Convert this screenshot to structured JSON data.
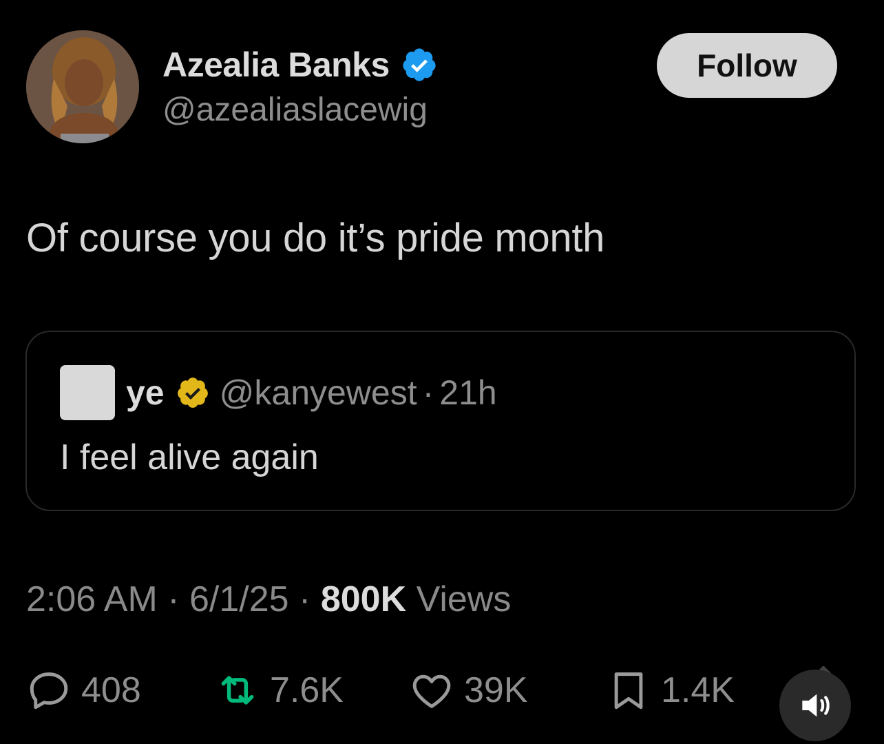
{
  "author": {
    "display_name": "Azealia Banks",
    "handle": "@azealiaslacewig",
    "verified_color": "#1d9bf0"
  },
  "follow_button": {
    "label": "Follow"
  },
  "tweet": {
    "text": "Of course you do it’s pride month"
  },
  "quoted": {
    "display_name": "ye",
    "handle": "@kanyewest",
    "separator": "·",
    "age": "21h",
    "text": "I feel alive again",
    "badge_color": "#e2b719"
  },
  "meta": {
    "time": "2:06 AM",
    "sep1": " · ",
    "date": "6/1/25",
    "sep2": " · ",
    "views_count": "800K",
    "views_label": " Views"
  },
  "actions": {
    "replies": "408",
    "reposts": "7.6K",
    "likes": "39K",
    "bookmarks": "1.4K",
    "repost_color": "#00ba7c"
  },
  "icons": {
    "avatar": "profile-photo",
    "verified": "verified-badge-icon",
    "quoted_verified": "gold-verified-badge-icon",
    "reply": "reply-icon",
    "repost": "repost-icon",
    "like": "heart-icon",
    "bookmark": "bookmark-icon",
    "sound": "speaker-icon"
  }
}
